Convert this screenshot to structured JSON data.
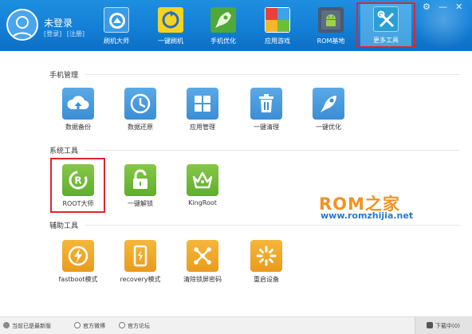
{
  "header": {
    "login_title": "未登录",
    "login_link": "[登录]",
    "register_link": "[注册]",
    "nav": [
      {
        "label": "刷机大师",
        "icon": "brush-machine-icon"
      },
      {
        "label": "一键刷机",
        "icon": "one-click-flash-icon"
      },
      {
        "label": "手机优化",
        "icon": "rocket-icon"
      },
      {
        "label": "应用游戏",
        "icon": "apps-grid-icon"
      },
      {
        "label": "ROM基地",
        "icon": "android-robot-icon"
      },
      {
        "label": "更多工具",
        "icon": "tools-icon"
      }
    ],
    "settings_glyph": "⚙",
    "min_glyph": "—",
    "close_glyph": "✕"
  },
  "sections": {
    "phone_mgmt": {
      "title": "手机管理",
      "items": [
        {
          "label": "数据备份",
          "icon": "cloud-upload-icon"
        },
        {
          "label": "数据还原",
          "icon": "clock-icon"
        },
        {
          "label": "应用管理",
          "icon": "app-grid-icon"
        },
        {
          "label": "一键清理",
          "icon": "trash-icon"
        },
        {
          "label": "一键优化",
          "icon": "rocket-icon"
        }
      ]
    },
    "system_tools": {
      "title": "系统工具",
      "items": [
        {
          "label": "ROOT大师",
          "icon": "root-master-icon"
        },
        {
          "label": "一键解锁",
          "icon": "unlock-icon"
        },
        {
          "label": "KingRoot",
          "icon": "crown-icon"
        }
      ]
    },
    "aux_tools": {
      "title": "辅助工具",
      "items": [
        {
          "label": "fastboot模式",
          "icon": "lightning-icon"
        },
        {
          "label": "recovery模式",
          "icon": "phone-recovery-icon"
        },
        {
          "label": "清除锁屏密码",
          "icon": "pattern-lock-icon"
        },
        {
          "label": "重启设备",
          "icon": "restart-spinner-icon"
        }
      ]
    }
  },
  "watermark": {
    "logo_a": "ROM",
    "logo_b": "之家",
    "url": "www.romzhijia.net"
  },
  "footer": {
    "status": "当前已是最新版",
    "weibo": "官方微博",
    "forum": "官方论坛",
    "download": "下载中(0)"
  },
  "colors": {
    "header": "#137fd6",
    "highlight": "#e0262b",
    "tile_blue": "#4a9be0",
    "tile_green": "#6cb834",
    "tile_orange": "#f0a828"
  }
}
